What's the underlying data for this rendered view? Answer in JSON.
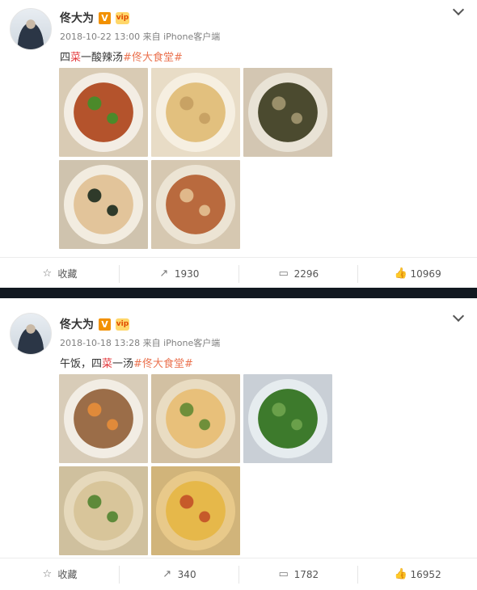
{
  "posts": [
    {
      "author": "佟大为",
      "v_badge": "V",
      "vip_badge": "vip",
      "time": "2018-10-22 13:00",
      "source": "来自 iPhone客户端",
      "text_pre": "四",
      "text_red": "菜",
      "text_post": "一酸辣汤",
      "tag": "#佟大食堂#",
      "actions": {
        "fav": "收藏",
        "repost": "1930",
        "comment": "2296",
        "like": "10969"
      },
      "photos": [
        {
          "bg": "#d9cbb4",
          "plate": "#f3ede4",
          "food": "#b4532c",
          "accent": "#4b8a2a"
        },
        {
          "bg": "#e8dcc6",
          "plate": "#f6efe1",
          "food": "#e2c07e",
          "accent": "#c8a264"
        },
        {
          "bg": "#d3c6b2",
          "plate": "#e9e3d6",
          "food": "#4b4a2f",
          "accent": "#9a8f6a"
        },
        {
          "bg": "#cfc3ae",
          "plate": "#f2ece0",
          "food": "#e2c49a",
          "accent": "#2f3a2a"
        },
        {
          "bg": "#d6c8b1",
          "plate": "#ece4d4",
          "food": "#b96a3e",
          "accent": "#e0b88a"
        }
      ]
    },
    {
      "author": "佟大为",
      "v_badge": "V",
      "vip_badge": "vip",
      "time": "2018-10-18 13:28",
      "source": "来自 iPhone客户端",
      "text_pre": "午饭，四",
      "text_red": "菜",
      "text_post": "一汤",
      "tag": "#佟大食堂#",
      "actions": {
        "fav": "收藏",
        "repost": "340",
        "comment": "1782",
        "like": "16952"
      },
      "photos": [
        {
          "bg": "#d8ccb8",
          "plate": "#f2ede4",
          "food": "#9b6d48",
          "accent": "#e08a3a"
        },
        {
          "bg": "#d2c0a2",
          "plate": "#e9dcc2",
          "food": "#e8c07a",
          "accent": "#6f8f3a"
        },
        {
          "bg": "#c9cfd6",
          "plate": "#e6ecef",
          "food": "#3d7a2c",
          "accent": "#6aa04a"
        },
        {
          "bg": "#cfc09e",
          "plate": "#e6d9bc",
          "food": "#d8c59a",
          "accent": "#5e8a3a"
        },
        {
          "bg": "#d1b47a",
          "plate": "#e8c98a",
          "food": "#e6b84a",
          "accent": "#c65a2a"
        }
      ]
    }
  ]
}
